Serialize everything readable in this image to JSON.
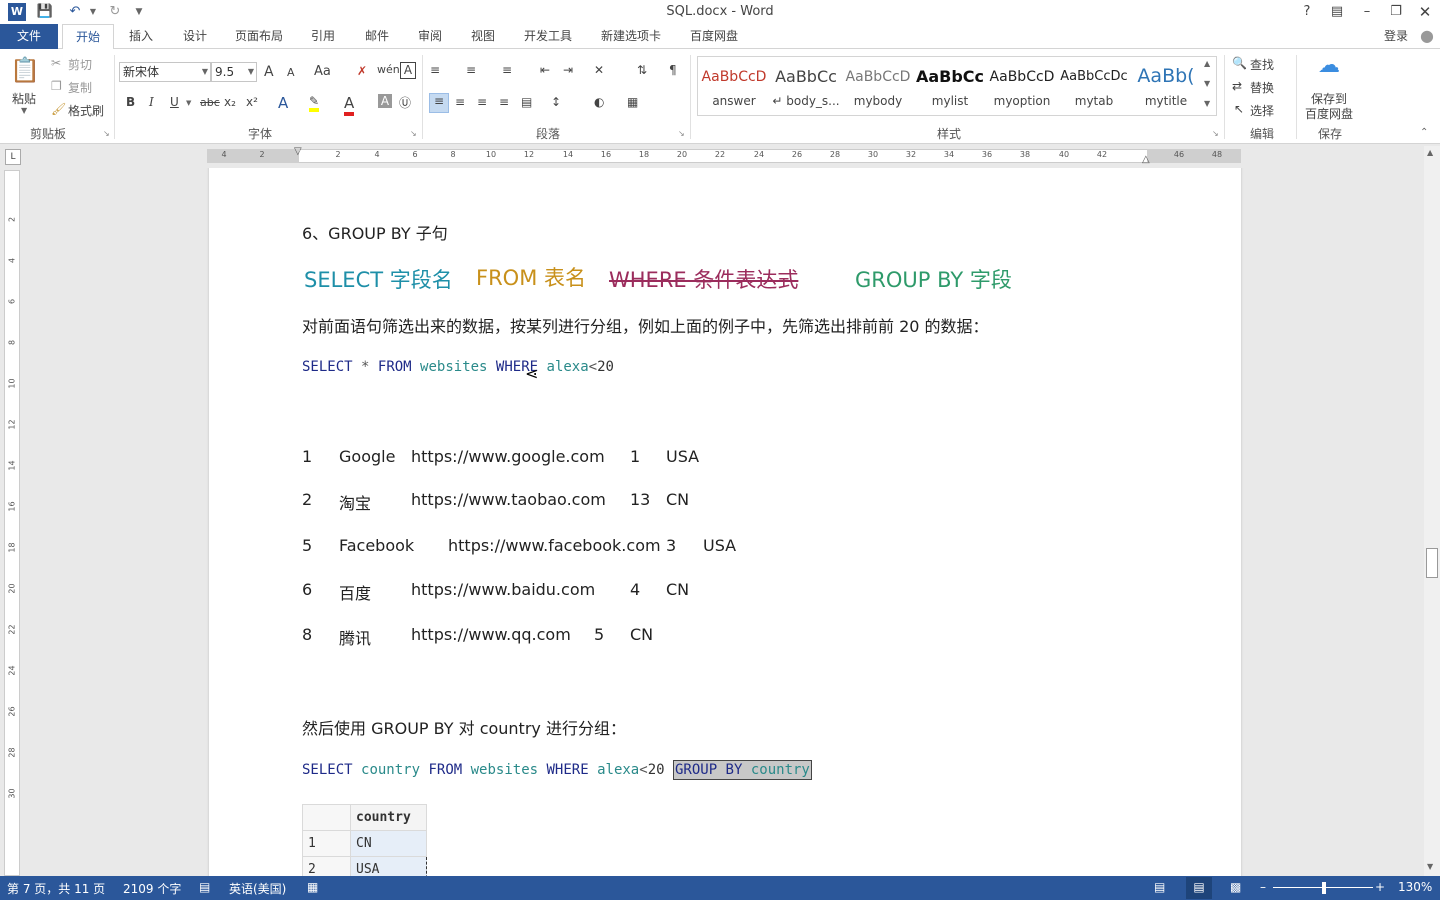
{
  "window": {
    "title": "SQL.docx - Word",
    "login": "登录"
  },
  "tabs": [
    "文件",
    "开始",
    "插入",
    "设计",
    "页面布局",
    "引用",
    "邮件",
    "审阅",
    "视图",
    "开发工具",
    "新建选项卡",
    "百度网盘"
  ],
  "ribbon": {
    "clipboard": {
      "paste": "粘贴",
      "cut": "剪切",
      "copy": "复制",
      "format_painter": "格式刷",
      "label": "剪贴板"
    },
    "font": {
      "name": "新宋体",
      "size": "9.5",
      "label": "字体",
      "bold": "B",
      "italic": "I",
      "underline": "U",
      "strike": "abc",
      "sub": "x₂",
      "sup": "x²",
      "grow": "A",
      "shrink": "A",
      "case": "Aa",
      "font_color_glyph": "A"
    },
    "paragraph": {
      "label": "段落"
    },
    "styles": {
      "label": "样式",
      "items": [
        {
          "sample": "AaBbCcD",
          "name": "answer",
          "color": "#c0392b"
        },
        {
          "sample": "AaBbCc",
          "name": "↵ body_s...",
          "color": "#444444"
        },
        {
          "sample": "AaBbCcD",
          "name": "mybody",
          "color": "#777777"
        },
        {
          "sample": "AaBbCc",
          "name": "mylist",
          "color": "#111111"
        },
        {
          "sample": "AaBbCcD",
          "name": "myoption",
          "color": "#222222"
        },
        {
          "sample": "AaBbCcDc",
          "name": "mytab",
          "color": "#222222"
        },
        {
          "sample": "AaBb(",
          "name": "mytitle",
          "color": "#2e74b5"
        }
      ]
    },
    "editing": {
      "find": "查找",
      "replace": "替换",
      "select": "选择",
      "label": "编辑"
    },
    "save": {
      "line1": "保存到",
      "line2": "百度网盘",
      "label": "保存"
    }
  },
  "ruler": {
    "h_ticks": [
      "4",
      "2",
      "2",
      "4",
      "6",
      "8",
      "10",
      "12",
      "14",
      "16",
      "18",
      "20",
      "22",
      "24",
      "26",
      "28",
      "30",
      "32",
      "34",
      "36",
      "38",
      "40",
      "42",
      "46",
      "48"
    ],
    "v_ticks": [
      "2",
      "4",
      "6",
      "8",
      "10",
      "12",
      "14",
      "16",
      "18",
      "20",
      "22",
      "24",
      "26",
      "28",
      "30"
    ]
  },
  "doc": {
    "heading": "6、GROUP BY  子句",
    "syntax": {
      "select": "SELECT 字段名",
      "from": "FROM 表名",
      "where": "WHERE 条件表达式",
      "groupby": "GROUP BY 字段"
    },
    "para1": "对前面语句筛选出来的数据，按某列进行分组，例如上面的例子中，先筛选出排前前 20 的数据：",
    "sql1": {
      "a": "SELECT",
      "b": "*",
      "c": "FROM",
      "d": "websites",
      "e": "WHERE",
      "f": "alexa",
      "g": "<",
      "h": "20"
    },
    "rows": [
      [
        "1",
        "Google",
        "https://www.google.com",
        "1",
        "USA"
      ],
      [
        "2",
        "淘宝",
        "https://www.taobao.com",
        "13",
        "CN"
      ],
      [
        "5",
        "Facebook",
        "https://www.facebook.com",
        "3",
        "USA"
      ],
      [
        "6",
        "百度",
        "https://www.baidu.com",
        "4",
        "CN"
      ],
      [
        "8",
        "腾讯",
        "https://www.qq.com",
        "5",
        "CN"
      ]
    ],
    "para2": "然后使用 GROUP BY 对 country 进行分组：",
    "sql2": {
      "a": "SELECT",
      "b": "country",
      "c": "FROM",
      "d": "websites",
      "e": "WHERE",
      "f": "alexa",
      "g": "<",
      "h": "20",
      "i": "GROUP BY",
      "j": "country"
    },
    "result": {
      "header": "country",
      "rows": [
        [
          "1",
          "CN"
        ],
        [
          "2",
          "USA"
        ]
      ]
    }
  },
  "status": {
    "page": "第 7 页，共 11 页",
    "words": "2109 个字",
    "lang": "英语(美国)",
    "zoom": "130%"
  },
  "colors": {
    "accent": "#2b579a",
    "select": "#1e8fa8",
    "from": "#c8901a",
    "where": "#9b2c5c",
    "groupby": "#2e9a6a"
  }
}
